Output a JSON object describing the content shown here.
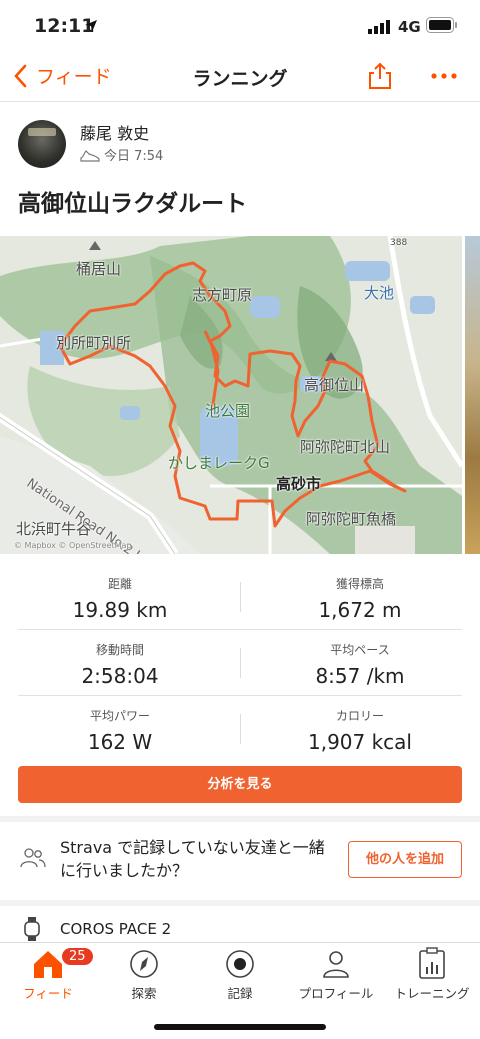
{
  "status": {
    "time": "12:11",
    "network": "4G"
  },
  "nav": {
    "back_label": "フィード",
    "title": "ランニング"
  },
  "athlete": {
    "name": "藤尾 敦史",
    "time": "今日 7:54"
  },
  "activity": {
    "title": "高御位山ラクダルート"
  },
  "map": {
    "labels": {
      "hikiyama": "桶居山",
      "shikata": "志方町原",
      "ooike": "大池",
      "besho": "別所町別所",
      "koen": "池公園",
      "takamikura": "高御位山",
      "road": "National Road No.2 Line",
      "kashima": "かしまレークG",
      "amida_kita": "阿弥陀町北山",
      "takasago": "高砂市",
      "amida_uo": "阿弥陀町魚橋",
      "kitahama": "北浜町牛谷",
      "route_num": "388",
      "attribution": "© Mapbox © OpenStreetMap"
    }
  },
  "stats": [
    {
      "label": "距離",
      "value": "19.89 km"
    },
    {
      "label": "獲得標高",
      "value": "1,672 m"
    },
    {
      "label": "移動時間",
      "value": "2:58:04"
    },
    {
      "label": "平均ペース",
      "value": "8:57 /km"
    },
    {
      "label": "平均パワー",
      "value": "162 W"
    },
    {
      "label": "カロリー",
      "value": "1,907 kcal"
    }
  ],
  "analysis_button": "分析を見る",
  "invite": {
    "text": "Strava で記録していない友達と一緒に行いましたか？",
    "button": "他の人を追加"
  },
  "device": "COROS PACE 2",
  "tabs": [
    {
      "label": "フィード",
      "badge": "25"
    },
    {
      "label": "探索"
    },
    {
      "label": "記録"
    },
    {
      "label": "プロフィール"
    },
    {
      "label": "トレーニング"
    }
  ],
  "colors": {
    "accent": "#fc5200",
    "route": "#f0622f"
  }
}
